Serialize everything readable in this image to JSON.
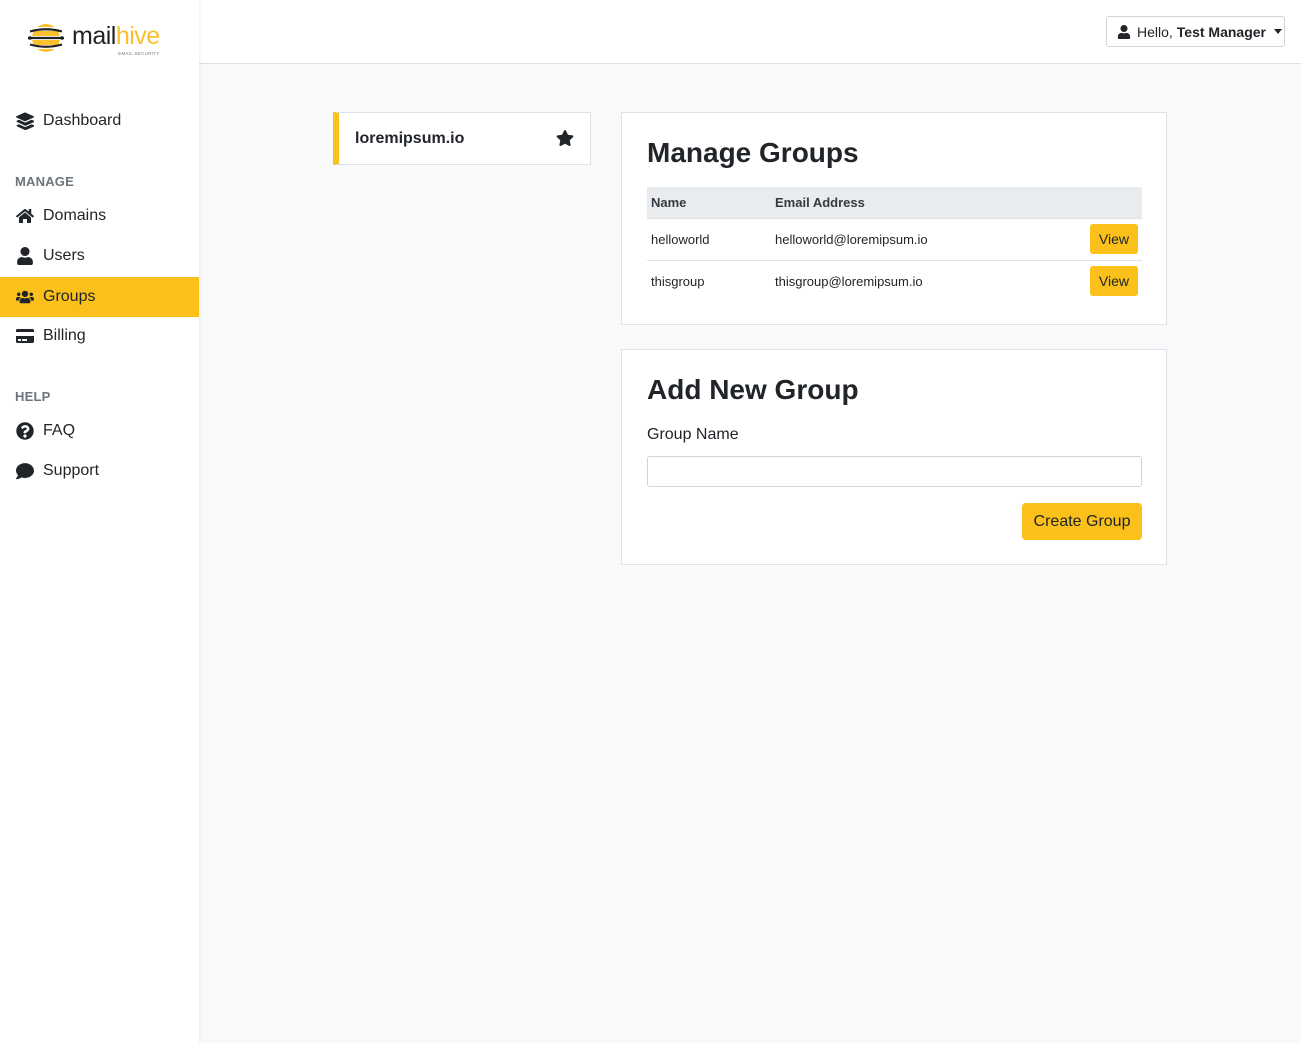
{
  "brand": {
    "name_part1": "mail",
    "name_part2": "hive",
    "tagline": "EMAIL SECURITY",
    "accent_color": "#fbc01a"
  },
  "sidebar": {
    "dashboard": {
      "label": "Dashboard",
      "icon": "layers-icon"
    },
    "manage_heading": "MANAGE",
    "manage_items": [
      {
        "label": "Domains",
        "icon": "home-icon"
      },
      {
        "label": "Users",
        "icon": "user-icon"
      },
      {
        "label": "Groups",
        "icon": "users-icon",
        "active": true
      },
      {
        "label": "Billing",
        "icon": "credit-card-icon"
      }
    ],
    "help_heading": "HELP",
    "help_items": [
      {
        "label": "FAQ",
        "icon": "question-circle-icon"
      },
      {
        "label": "Support",
        "icon": "comment-icon"
      }
    ]
  },
  "header": {
    "greeting": "Hello,",
    "user_name": "Test Manager"
  },
  "domain": {
    "name": "loremipsum.io"
  },
  "manage_groups": {
    "title": "Manage Groups",
    "columns": [
      "Name",
      "Email Address"
    ],
    "rows": [
      {
        "name": "helloworld",
        "email": "helloworld@loremipsum.io",
        "action": "View"
      },
      {
        "name": "thisgroup",
        "email": "thisgroup@loremipsum.io",
        "action": "View"
      }
    ]
  },
  "add_group": {
    "title": "Add New Group",
    "field_label": "Group Name",
    "field_value": "",
    "submit_label": "Create Group"
  }
}
